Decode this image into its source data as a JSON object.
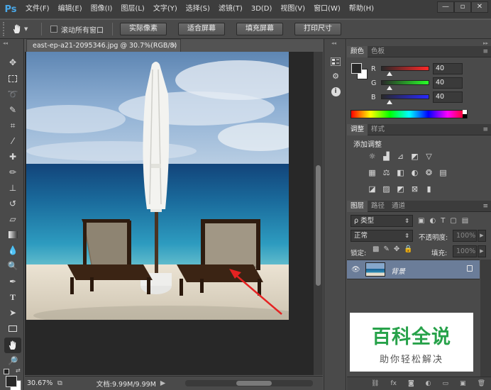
{
  "app": {
    "logo": "Ps"
  },
  "menubar": {
    "items": [
      "文件(F)",
      "编辑(E)",
      "图像(I)",
      "图层(L)",
      "文字(Y)",
      "选择(S)",
      "滤镜(T)",
      "3D(D)",
      "视图(V)",
      "窗口(W)",
      "帮助(H)"
    ],
    "window_controls": {
      "minimize": "—",
      "restore": "▫",
      "close": "✕"
    }
  },
  "options_bar": {
    "scroll_all_windows": {
      "label": "滚动所有窗口",
      "checked": false
    },
    "buttons": [
      "实际像素",
      "适合屏幕",
      "填充屏幕",
      "打印尺寸"
    ]
  },
  "document": {
    "tab_title": "east-ep-a21-2095346.jpg @ 30.7%(RGB/8)",
    "close_symbol": "×"
  },
  "statusbar": {
    "zoom": "30.67%",
    "doc_info": "文档:9.99M/9.99M",
    "arrow": "▶"
  },
  "color_panel": {
    "tabs": [
      "颜色",
      "色板"
    ],
    "channels": [
      {
        "label": "R",
        "value": "40",
        "level": 0.157
      },
      {
        "label": "G",
        "value": "40",
        "level": 0.157
      },
      {
        "label": "B",
        "value": "40",
        "level": 0.157
      }
    ],
    "foreground": "#282828",
    "background": "#ffffff"
  },
  "adjustments_panel": {
    "tabs": [
      "调整",
      "样式"
    ],
    "title": "添加调整"
  },
  "layers_panel": {
    "tabs": [
      "图层",
      "路径",
      "通道"
    ],
    "filter_kind": "类型",
    "blend_mode": "正常",
    "opacity_label": "不透明度:",
    "opacity_value": "100%",
    "lock_label": "锁定:",
    "fill_label": "填充:",
    "fill_value": "100%",
    "layer_name": "背景"
  },
  "watermark": {
    "title": "百科全说",
    "subtitle": "助你轻松解决"
  },
  "colors": {
    "accent": "#4aa8e8",
    "selected_layer": "#6b7d99",
    "watermark_green": "#27a24a"
  }
}
